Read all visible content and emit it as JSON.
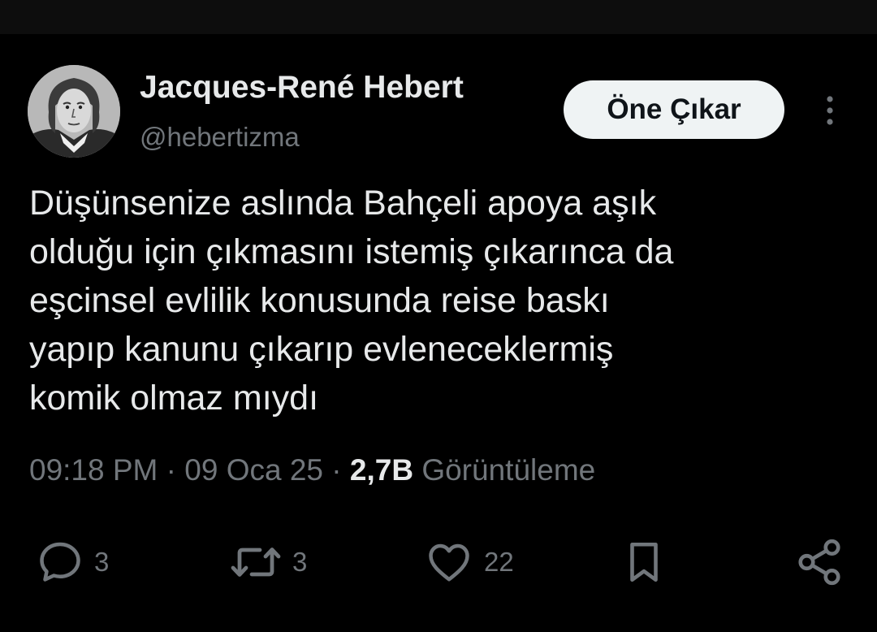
{
  "author": {
    "name": "Jacques-René Hebert",
    "handle": "@hebertizma"
  },
  "follow_button": {
    "label": "Öne Çıkar"
  },
  "tweet": {
    "text": "Düşünsenize aslında Bahçeli apoya aşık\nolduğu için çıkmasını istemiş çıkarınca da\neşcinsel evlilik konusunda reise baskı\nyapıp kanunu çıkarıp evleneceklermiş\nkomik olmaz mıydı"
  },
  "meta": {
    "time": "09:18 PM",
    "separator": " · ",
    "date": "09 Oca 25",
    "dot": " · ",
    "views_count": "2,7B",
    "views_label": " Görüntüleme"
  },
  "actions": {
    "reply": {
      "icon": "reply-icon",
      "count": "3"
    },
    "repost": {
      "icon": "repost-icon",
      "count": "3"
    },
    "like": {
      "icon": "heart-icon",
      "count": "22"
    },
    "bookmark": {
      "icon": "bookmark-icon"
    },
    "share": {
      "icon": "share-icon"
    }
  },
  "colors": {
    "background": "#000000",
    "primary_text": "#e7e9ea",
    "secondary_text": "#71767b",
    "button_bg": "#eff3f4"
  }
}
